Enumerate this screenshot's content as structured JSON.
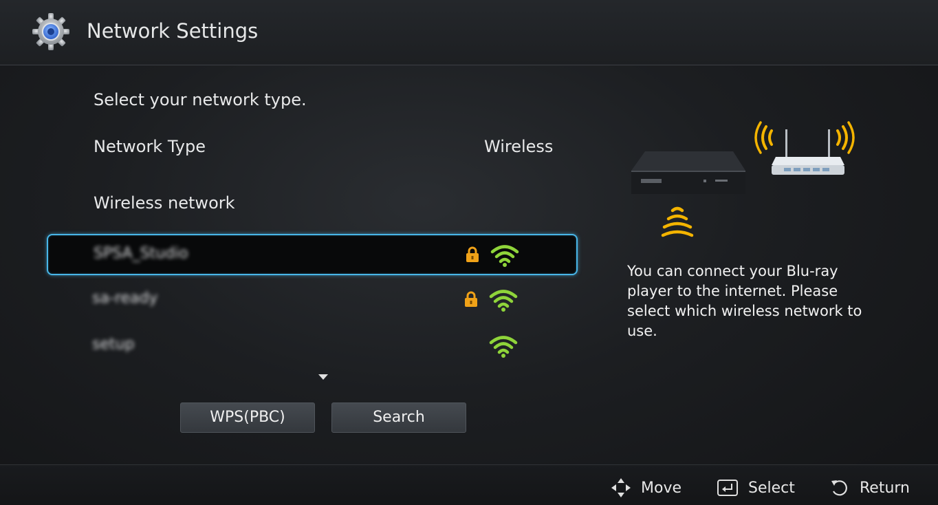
{
  "header": {
    "title": "Network Settings",
    "icon": "gear-icon"
  },
  "instruction": "Select your network type.",
  "network_type": {
    "label": "Network Type",
    "value": "Wireless"
  },
  "wireless_section": {
    "heading": "Wireless network",
    "networks": [
      {
        "ssid": "SPSA_Studio",
        "locked": true,
        "selected": true
      },
      {
        "ssid": "sa-ready",
        "locked": true,
        "selected": false
      },
      {
        "ssid": "setup",
        "locked": false,
        "selected": false
      }
    ],
    "more_indicator": "chevron-down-icon"
  },
  "buttons": {
    "wps": "WPS(PBC)",
    "search": "Search"
  },
  "description": "You can connect your Blu-ray player to the internet. Please select which wireless network to use.",
  "footer": {
    "move": "Move",
    "select": "Select",
    "return": "Return"
  },
  "colors": {
    "selection_border": "#48b6e8",
    "wifi_signal": "#8fd43a",
    "lock": "#f0a218",
    "wave": "#f4b400"
  }
}
